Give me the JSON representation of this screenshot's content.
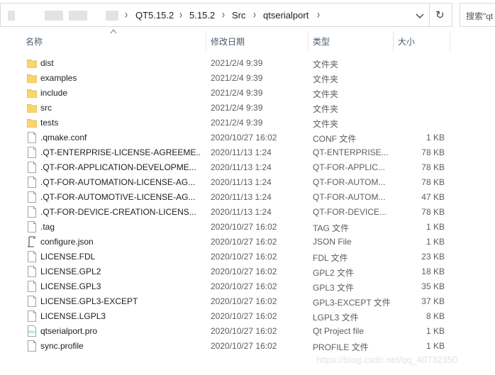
{
  "breadcrumb": {
    "items": [
      "QT5.15.2",
      "5.15.2",
      "Src",
      "qtserialport"
    ]
  },
  "search": {
    "placeholder": "搜索\"qt"
  },
  "columns": {
    "name": "名称",
    "date": "修改日期",
    "type": "类型",
    "size": "大小"
  },
  "files": [
    {
      "name": "dist",
      "date": "2021/2/4 9:39",
      "type": "文件夹",
      "size": "",
      "icon": "folder-icon"
    },
    {
      "name": "examples",
      "date": "2021/2/4 9:39",
      "type": "文件夹",
      "size": "",
      "icon": "folder-icon"
    },
    {
      "name": "include",
      "date": "2021/2/4 9:39",
      "type": "文件夹",
      "size": "",
      "icon": "folder-icon"
    },
    {
      "name": "src",
      "date": "2021/2/4 9:39",
      "type": "文件夹",
      "size": "",
      "icon": "folder-icon"
    },
    {
      "name": "tests",
      "date": "2021/2/4 9:39",
      "type": "文件夹",
      "size": "",
      "icon": "folder-icon"
    },
    {
      "name": ".qmake.conf",
      "date": "2020/10/27 16:02",
      "type": "CONF 文件",
      "size": "1 KB",
      "icon": "file-icon"
    },
    {
      "name": ".QT-ENTERPRISE-LICENSE-AGREEME...",
      "date": "2020/11/13 1:24",
      "type": "QT-ENTERPRISE...",
      "size": "78 KB",
      "icon": "file-icon"
    },
    {
      "name": ".QT-FOR-APPLICATION-DEVELOPME...",
      "date": "2020/11/13 1:24",
      "type": "QT-FOR-APPLIC...",
      "size": "78 KB",
      "icon": "file-icon"
    },
    {
      "name": ".QT-FOR-AUTOMATION-LICENSE-AG...",
      "date": "2020/11/13 1:24",
      "type": "QT-FOR-AUTOM...",
      "size": "78 KB",
      "icon": "file-icon"
    },
    {
      "name": ".QT-FOR-AUTOMOTIVE-LICENSE-AG...",
      "date": "2020/11/13 1:24",
      "type": "QT-FOR-AUTOM...",
      "size": "47 KB",
      "icon": "file-icon"
    },
    {
      "name": ".QT-FOR-DEVICE-CREATION-LICENS...",
      "date": "2020/11/13 1:24",
      "type": "QT-FOR-DEVICE...",
      "size": "78 KB",
      "icon": "file-icon"
    },
    {
      "name": ".tag",
      "date": "2020/10/27 16:02",
      "type": "TAG 文件",
      "size": "1 KB",
      "icon": "file-icon"
    },
    {
      "name": "configure.json",
      "date": "2020/10/27 16:02",
      "type": "JSON File",
      "size": "1 KB",
      "icon": "json-file-icon"
    },
    {
      "name": "LICENSE.FDL",
      "date": "2020/10/27 16:02",
      "type": "FDL 文件",
      "size": "23 KB",
      "icon": "file-icon"
    },
    {
      "name": "LICENSE.GPL2",
      "date": "2020/10/27 16:02",
      "type": "GPL2 文件",
      "size": "18 KB",
      "icon": "file-icon"
    },
    {
      "name": "LICENSE.GPL3",
      "date": "2020/10/27 16:02",
      "type": "GPL3 文件",
      "size": "35 KB",
      "icon": "file-icon"
    },
    {
      "name": "LICENSE.GPL3-EXCEPT",
      "date": "2020/10/27 16:02",
      "type": "GPL3-EXCEPT 文件",
      "size": "37 KB",
      "icon": "file-icon"
    },
    {
      "name": "LICENSE.LGPL3",
      "date": "2020/10/27 16:02",
      "type": "LGPL3 文件",
      "size": "8 KB",
      "icon": "file-icon"
    },
    {
      "name": "qtserialport.pro",
      "date": "2020/10/27 16:02",
      "type": "Qt Project file",
      "size": "1 KB",
      "icon": "qt-project-file-icon"
    },
    {
      "name": "sync.profile",
      "date": "2020/10/27 16:02",
      "type": "PROFILE 文件",
      "size": "1 KB",
      "icon": "file-icon"
    }
  ],
  "watermark": "https://blog.csdn.net/qq_40732350",
  "colors": {
    "folder": "#f8d775",
    "header_text": "#4a5a6e"
  }
}
